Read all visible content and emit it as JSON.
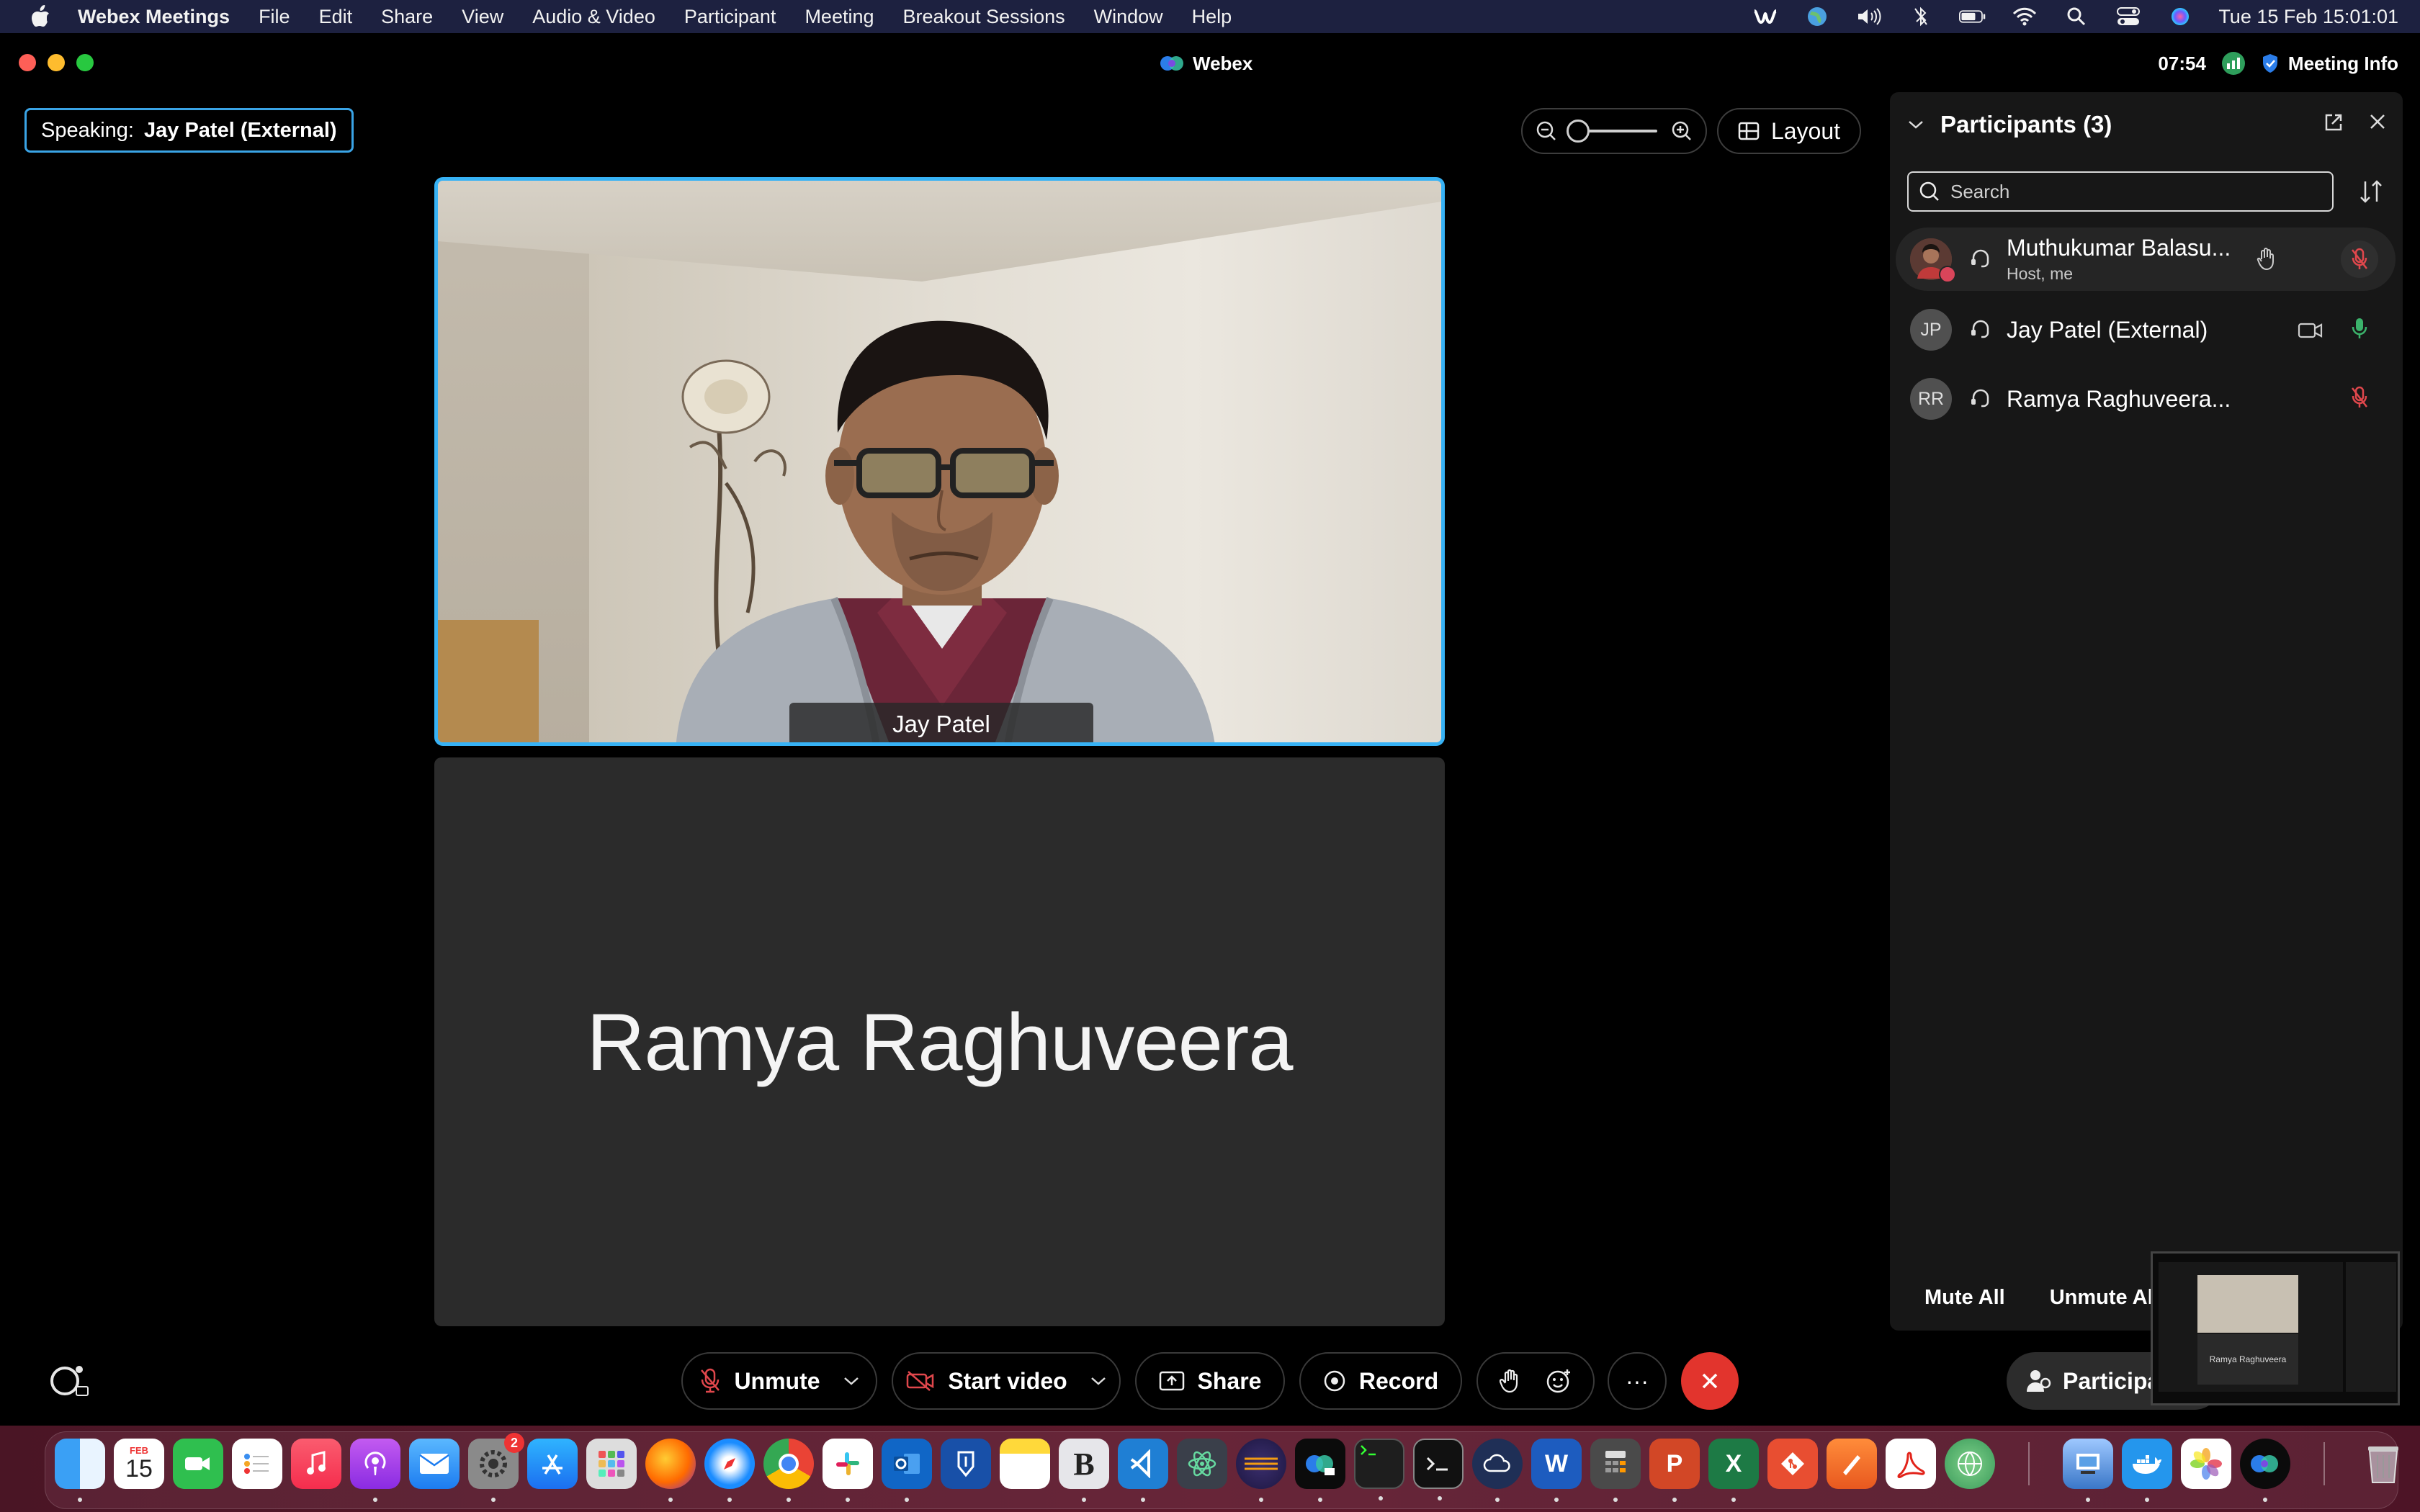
{
  "menubar": {
    "app_name": "Webex Meetings",
    "menus": [
      "File",
      "Edit",
      "Share",
      "View",
      "Audio & Video",
      "Participant",
      "Meeting",
      "Breakout Sessions",
      "Window",
      "Help"
    ],
    "clock": "Tue 15 Feb  15:01:01",
    "status_icons": [
      "webex-status-icon",
      "vpn-globe-icon",
      "volume-icon",
      "bluetooth-icon",
      "battery-icon",
      "wifi-icon",
      "spotlight-search-icon",
      "control-center-icon",
      "siri-icon"
    ]
  },
  "window": {
    "title": "Webex",
    "timer": "07:54",
    "meeting_info": "Meeting Info"
  },
  "speaking": {
    "label": "Speaking:",
    "name": "Jay Patel (External)"
  },
  "toolbar": {
    "layout_label": "Layout"
  },
  "tiles": [
    {
      "name": "Jay Patel",
      "type": "video"
    },
    {
      "name": "Ramya Raghuveera",
      "type": "no-video"
    }
  ],
  "controls": {
    "unmute": "Unmute",
    "start_video": "Start video",
    "share": "Share",
    "record": "Record",
    "more": "···",
    "participants": "Participa"
  },
  "participants_panel": {
    "title": "Participants (3)",
    "search_placeholder": "Search",
    "list": [
      {
        "name": "Muthukumar Balasu...",
        "role": "Host, me",
        "initials": "",
        "mic": "muted",
        "extra_icon": "hand-icon"
      },
      {
        "name": "Jay Patel (External)",
        "role": "",
        "initials": "JP",
        "mic": "unmuted",
        "extra_icon": "video-icon"
      },
      {
        "name": "Ramya Raghuveera...",
        "role": "",
        "initials": "RR",
        "mic": "muted",
        "extra_icon": ""
      }
    ],
    "mute_all": "Mute All",
    "unmute_all": "Unmute Al"
  },
  "preview": {
    "caption": "Ramya Raghuveera"
  },
  "dock": {
    "calendar_month": "FEB",
    "calendar_day": "15",
    "badge_count": "2",
    "apps": [
      "finder-icon",
      "calendar-icon",
      "facetime-icon",
      "reminders-icon",
      "music-icon",
      "podcasts-icon",
      "mail-icon",
      "system-preferences-icon",
      "app-store-icon",
      "launchpad-icon",
      "firefox-icon",
      "safari-icon",
      "chrome-icon",
      "slack-icon",
      "outlook-icon",
      "keypass-icon",
      "notes-icon",
      "bbedit-icon",
      "vscode-icon",
      "atom-icon",
      "eclipse-icon",
      "webex-teams-icon",
      "terminal-icon",
      "iterm-icon",
      "cisco-cloud-icon",
      "word-icon",
      "calculator-icon",
      "powerpoint-icon",
      "excel-icon",
      "git-icon",
      "sketch-icon",
      "acrobat-icon",
      "network-globe-icon",
      "preview-icon",
      "docker-icon",
      "photos-icon",
      "webex-meetings-icon",
      "trash-icon"
    ]
  },
  "colors": {
    "accent_blue": "#37b2f5",
    "end_call_red": "#e2342d",
    "menubar_bg": "#1d2140",
    "mute_red": "#e0474c",
    "mic_green": "#3bb36b"
  }
}
